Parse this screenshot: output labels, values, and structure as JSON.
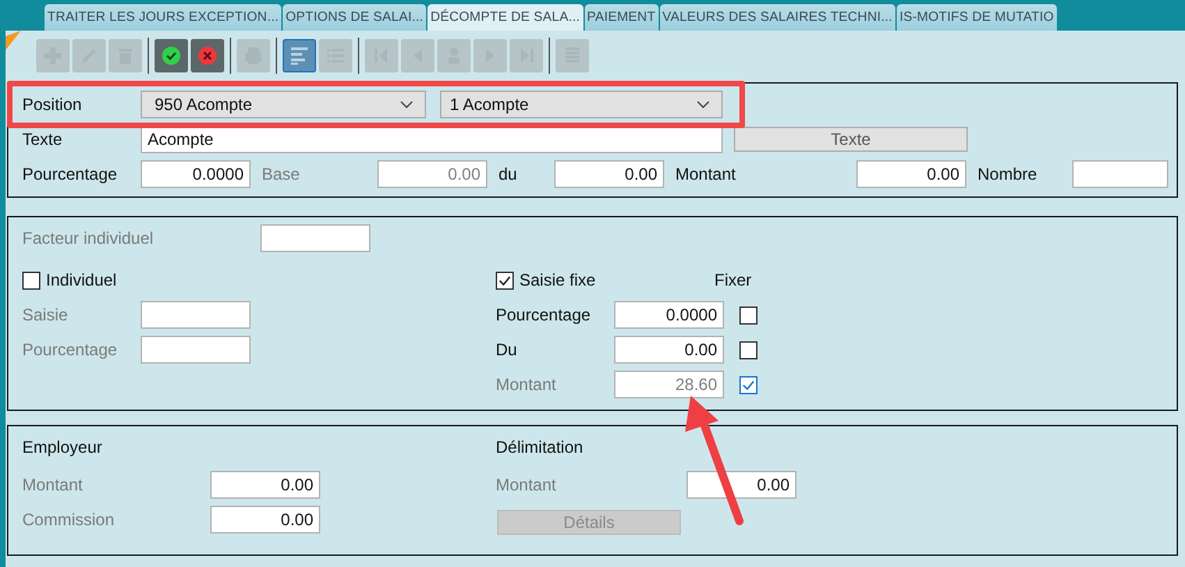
{
  "tabs": [
    {
      "label": "TRAITER LES JOURS EXCEPTION...",
      "selected": false
    },
    {
      "label": "OPTIONS DE SALAI...",
      "selected": false
    },
    {
      "label": "DÉCOMPTE DE SALA...",
      "selected": true
    },
    {
      "label": "PAIEMENT",
      "selected": false
    },
    {
      "label": "VALEURS DES SALAIRES TECHNI...",
      "selected": false
    },
    {
      "label": "IS-MOTIFS DE MUTATIO",
      "selected": false
    }
  ],
  "toolbar": [
    [
      {
        "kind": "add",
        "disabled": true,
        "selected": false
      },
      {
        "kind": "edit",
        "disabled": true,
        "selected": false
      },
      {
        "kind": "delete",
        "disabled": true,
        "selected": false
      }
    ],
    [
      {
        "kind": "confirm",
        "disabled": false,
        "selected": false
      },
      {
        "kind": "cancel",
        "disabled": false,
        "selected": false
      }
    ],
    [
      {
        "kind": "print",
        "disabled": true,
        "selected": false
      }
    ],
    [
      {
        "kind": "detail",
        "disabled": false,
        "selected": true
      },
      {
        "kind": "list",
        "disabled": true,
        "selected": false
      }
    ],
    [
      {
        "kind": "first",
        "disabled": true,
        "selected": false
      },
      {
        "kind": "prev",
        "disabled": true,
        "selected": false
      },
      {
        "kind": "person",
        "disabled": true,
        "selected": false
      },
      {
        "kind": "next",
        "disabled": true,
        "selected": false
      },
      {
        "kind": "last",
        "disabled": true,
        "selected": false
      }
    ],
    [
      {
        "kind": "grid",
        "disabled": true,
        "selected": false
      }
    ]
  ],
  "header": {
    "position": {
      "label": "Position",
      "selects": [
        "950 Acompte",
        "1 Acompte"
      ]
    },
    "texte": {
      "label": "Texte",
      "value": "Acompte",
      "button": "Texte"
    },
    "amounts": [
      {
        "label": "Pourcentage",
        "value": "0.0000",
        "disabled": false
      },
      {
        "label": "Base",
        "value": "0.00",
        "disabled": true
      },
      {
        "label": "du",
        "value": "0.00",
        "disabled": false
      },
      {
        "label": "Montant",
        "value": "0.00",
        "disabled": false
      },
      {
        "label": "Nombre",
        "disabled": false
      }
    ]
  },
  "individual": {
    "factor": {
      "label": "Facteur individuel",
      "disabled": true
    },
    "individuel": {
      "label": "Individuel",
      "checked": false
    },
    "left_fields": [
      {
        "label": "Saisie",
        "disabled": true
      },
      {
        "label": "Pourcentage",
        "disabled": true
      }
    ],
    "saisie_fixe": {
      "label": "Saisie fixe",
      "checked": true
    },
    "fixer_label": "Fixer",
    "right_fields": [
      {
        "label": "Pourcentage",
        "value": "0.0000",
        "disabled": false,
        "fixed": false
      },
      {
        "label": "Du",
        "value": "0.00",
        "disabled": false,
        "fixed": false
      },
      {
        "label": "Montant",
        "value": "28.60",
        "disabled": true,
        "fixed": true
      }
    ]
  },
  "employer": {
    "title": "Employeur",
    "fields": [
      {
        "label": "Montant",
        "value": "0.00",
        "disabled": true
      },
      {
        "label": "Commission",
        "value": "0.00",
        "disabled": true
      }
    ]
  },
  "delimitation": {
    "title": "Délimitation",
    "fields": [
      {
        "label": "Montant",
        "value": "0.00",
        "disabled": true
      }
    ],
    "button": {
      "label": "Détails",
      "disabled": true
    }
  }
}
